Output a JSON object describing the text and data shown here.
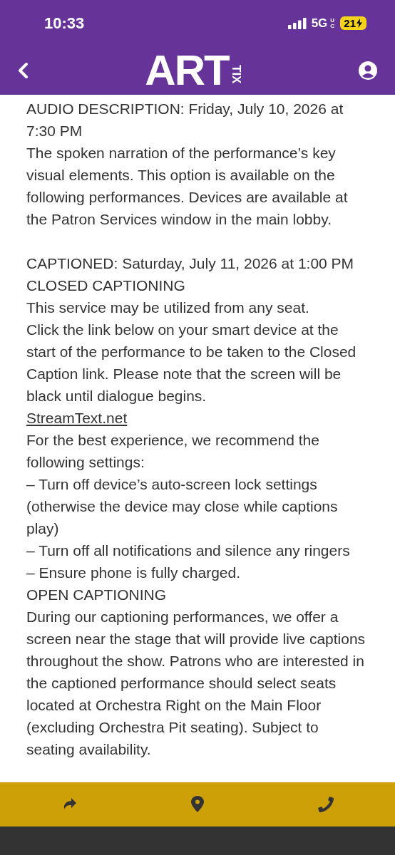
{
  "status_bar": {
    "time": "10:33",
    "network": "5G",
    "network_suffix": "UC",
    "battery": "21"
  },
  "header": {
    "logo_main": "ART",
    "logo_side": "TIX"
  },
  "sections": [
    {
      "lines": [
        {
          "kind": "text",
          "text": "AUDIO DESCRIPTION: Friday, July 10, 2026 at 7:30 PM"
        },
        {
          "kind": "text",
          "text": "The spoken narration of the performance’s key visual elements. This option is available on the following performances. Devices are available at the Patron Services window in the main lobby."
        }
      ]
    },
    {
      "lines": [
        {
          "kind": "text",
          "text": "CAPTIONED: Saturday, July 11, 2026 at 1:00 PM"
        },
        {
          "kind": "text",
          "text": "CLOSED CAPTIONING"
        },
        {
          "kind": "text",
          "text": "This service may be utilized from any seat."
        },
        {
          "kind": "text",
          "text": "Click the link below on your smart device at the start of the performance to be taken to the Closed Caption link. Please note that the screen will be black until dialogue begins."
        },
        {
          "kind": "link",
          "text": "StreamText.net"
        },
        {
          "kind": "text",
          "text": "For the best experience, we recommend the following settings:"
        },
        {
          "kind": "text",
          "text": "– Turn off device’s auto-screen lock settings (otherwise the device may close while captions play)"
        },
        {
          "kind": "text",
          "text": "– Turn off all notifications and silence any ringers"
        },
        {
          "kind": "text",
          "text": "– Ensure phone is fully charged."
        },
        {
          "kind": "text",
          "text": "OPEN CAPTIONING"
        },
        {
          "kind": "text",
          "text": "During our captioning performances, we offer a screen near the stage that will provide live captions throughout the show. Patrons who are interested in the captioned performance should select seats located at Orchestra Right on the Main Floor (excluding Orchestra Pit seating). Subject to seating availability."
        }
      ]
    }
  ]
}
